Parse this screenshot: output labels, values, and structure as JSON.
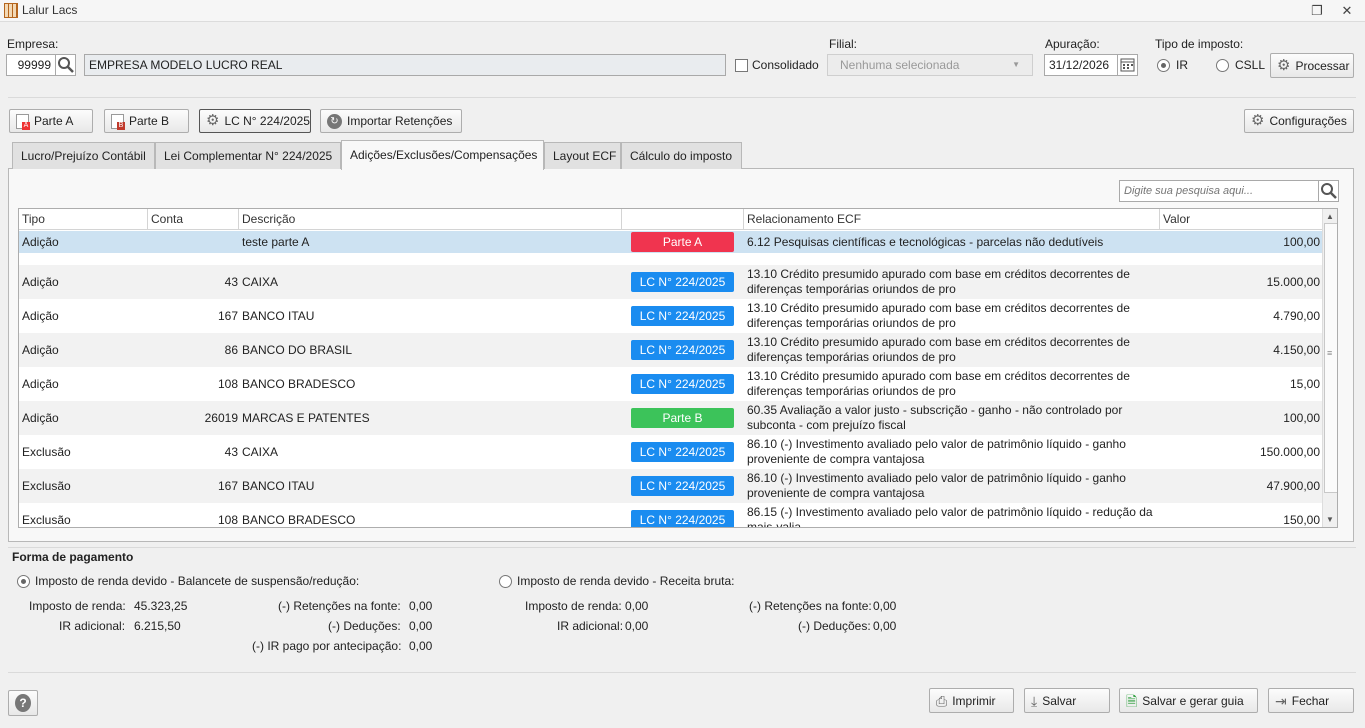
{
  "window": {
    "title": "Lalur Lacs"
  },
  "header": {
    "empresa_label": "Empresa:",
    "empresa_code": "99999",
    "empresa_name": "EMPRESA MODELO LUCRO REAL",
    "consolidado_label": "Consolidado",
    "filial_label": "Filial:",
    "filial_value": "Nenhuma selecionada",
    "apuracao_label": "Apuração:",
    "apuracao_value": "31/12/2026",
    "tipo_label": "Tipo de imposto:",
    "ir_label": "IR",
    "csll_label": "CSLL",
    "processar": "Processar"
  },
  "toolbar": {
    "parte_a": "Parte A",
    "parte_b": "Parte B",
    "lc": "LC N° 224/2025",
    "importar": "Importar Retenções",
    "config": "Configurações"
  },
  "tabs": [
    {
      "label": "Lucro/Prejuízo Contábil"
    },
    {
      "label": "Lei Complementar N° 224/2025"
    },
    {
      "label": "Adições/Exclusões/Compensações"
    },
    {
      "label": "Layout ECF"
    },
    {
      "label": "Cálculo do imposto"
    }
  ],
  "search": {
    "placeholder": "Digite sua pesquisa aqui..."
  },
  "grid": {
    "columns": [
      "Tipo",
      "Conta",
      "Descrição",
      "",
      "Relacionamento ECF",
      "Valor"
    ],
    "rows": [
      {
        "tipo": "Adição",
        "conta": "",
        "descricao": "teste parte A",
        "badge": "Parte A",
        "badge_color": "#f0344f",
        "ecf1": "6.12 Pesquisas científicas e tecnológicas - parcelas não dedutíveis",
        "ecf2": "",
        "valor": "100,00"
      },
      {
        "tipo": "Adição",
        "conta": "43",
        "descricao": "CAIXA",
        "badge": "LC N° 224/2025",
        "badge_color": "#1a8cf0",
        "ecf1": "13.10 Crédito presumido apurado com base em créditos decorrentes de",
        "ecf2": "diferenças temporárias oriundos de pro",
        "valor": "15.000,00"
      },
      {
        "tipo": "Adição",
        "conta": "167",
        "descricao": "BANCO ITAU",
        "badge": "LC N° 224/2025",
        "badge_color": "#1a8cf0",
        "ecf1": "13.10 Crédito presumido apurado com base em créditos decorrentes de",
        "ecf2": "diferenças temporárias oriundos de pro",
        "valor": "4.790,00"
      },
      {
        "tipo": "Adição",
        "conta": "86",
        "descricao": "BANCO DO BRASIL",
        "badge": "LC N° 224/2025",
        "badge_color": "#1a8cf0",
        "ecf1": "13.10 Crédito presumido apurado com base em créditos decorrentes de",
        "ecf2": "diferenças temporárias oriundos de pro",
        "valor": "4.150,00"
      },
      {
        "tipo": "Adição",
        "conta": "108",
        "descricao": "BANCO BRADESCO",
        "badge": "LC N° 224/2025",
        "badge_color": "#1a8cf0",
        "ecf1": "13.10 Crédito presumido apurado com base em créditos decorrentes de",
        "ecf2": "diferenças temporárias oriundos de pro",
        "valor": "15,00"
      },
      {
        "tipo": "Adição",
        "conta": "26019",
        "descricao": "MARCAS E PATENTES",
        "badge": "Parte B",
        "badge_color": "#3cc35a",
        "ecf1": "60.35 Avaliação a valor justo - subscrição - ganho - não controlado por",
        "ecf2": "subconta - com prejuízo fiscal",
        "valor": "100,00"
      },
      {
        "tipo": "Exclusão",
        "conta": "43",
        "descricao": "CAIXA",
        "badge": "LC N° 224/2025",
        "badge_color": "#1a8cf0",
        "ecf1": "86.10 (-) Investimento avaliado pelo valor de patrimônio líquido - ganho",
        "ecf2": "proveniente de compra vantajosa",
        "valor": "150.000,00"
      },
      {
        "tipo": "Exclusão",
        "conta": "167",
        "descricao": "BANCO ITAU",
        "badge": "LC N° 224/2025",
        "badge_color": "#1a8cf0",
        "ecf1": "86.10 (-) Investimento avaliado pelo valor de patrimônio líquido - ganho",
        "ecf2": "proveniente de compra vantajosa",
        "valor": "47.900,00"
      },
      {
        "tipo": "Exclusão",
        "conta": "108",
        "descricao": "BANCO BRADESCO",
        "badge": "LC N° 224/2025",
        "badge_color": "#1a8cf0",
        "ecf1": "86.15 (-) Investimento avaliado pelo valor de patrimônio líquido - redução da",
        "ecf2": "mais-valia",
        "valor": "150,00"
      }
    ]
  },
  "payment": {
    "title": "Forma de pagamento",
    "opt1": "Imposto de renda devido - Balancete de suspensão/redução:",
    "opt2": "Imposto de renda devido - Receita bruta:",
    "left": {
      "ir_label": "Imposto de renda:",
      "ir_value": "45.323,25",
      "adic_label": "IR adicional:",
      "adic_value": "6.215,50",
      "ret_label": "(-) Retenções na fonte:",
      "ret_value": "0,00",
      "ded_label": "(-) Deduções:",
      "ded_value": "0,00",
      "ant_label": "(-) IR pago por antecipação:",
      "ant_value": "0,00"
    },
    "right": {
      "ir_label": "Imposto de renda:",
      "ir_value": "0,00",
      "adic_label": "IR adicional:",
      "adic_value": "0,00",
      "ret_label": "(-) Retenções na fonte:",
      "ret_value": "0,00",
      "ded_label": "(-) Deduções:",
      "ded_value": "0,00"
    }
  },
  "footer": {
    "imprimir": "Imprimir",
    "salvar": "Salvar",
    "salvar_guia": "Salvar e gerar guia",
    "fechar": "Fechar"
  }
}
